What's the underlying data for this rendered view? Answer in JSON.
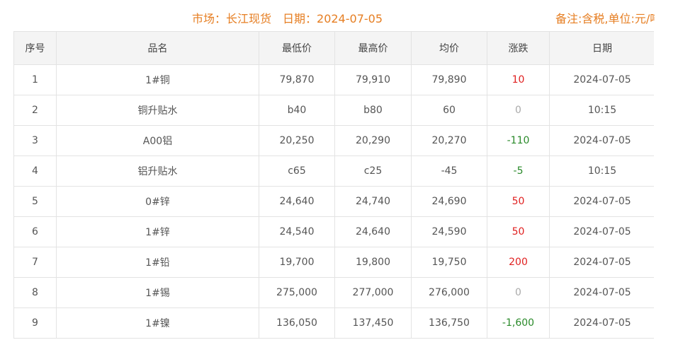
{
  "header": {
    "market_label": "市场：长江现货",
    "date_label": "日期：2024-07-05",
    "remark": "备注:含税,单位:元/吨"
  },
  "colors": {
    "accent": "#e67e22",
    "up": "#e02020",
    "down": "#2a8a2a",
    "flat": "#aaaaaa"
  },
  "table": {
    "columns": [
      "序号",
      "品名",
      "最低价",
      "最高价",
      "均价",
      "涨跌",
      "日期"
    ],
    "rows": [
      {
        "no": "1",
        "name": "1#铜",
        "low": "79,870",
        "high": "79,910",
        "avg": "79,890",
        "change": "10",
        "trend": "up",
        "date": "2024-07-05"
      },
      {
        "no": "2",
        "name": "铜升贴水",
        "low": "b40",
        "high": "b80",
        "avg": "60",
        "change": "0",
        "trend": "flat",
        "date": "10:15"
      },
      {
        "no": "3",
        "name": "A00铝",
        "low": "20,250",
        "high": "20,290",
        "avg": "20,270",
        "change": "-110",
        "trend": "down",
        "date": "2024-07-05"
      },
      {
        "no": "4",
        "name": "铝升贴水",
        "low": "c65",
        "high": "c25",
        "avg": "-45",
        "change": "-5",
        "trend": "down",
        "date": "10:15"
      },
      {
        "no": "5",
        "name": "0#锌",
        "low": "24,640",
        "high": "24,740",
        "avg": "24,690",
        "change": "50",
        "trend": "up",
        "date": "2024-07-05"
      },
      {
        "no": "6",
        "name": "1#锌",
        "low": "24,540",
        "high": "24,640",
        "avg": "24,590",
        "change": "50",
        "trend": "up",
        "date": "2024-07-05"
      },
      {
        "no": "7",
        "name": "1#铅",
        "low": "19,700",
        "high": "19,800",
        "avg": "19,750",
        "change": "200",
        "trend": "up",
        "date": "2024-07-05"
      },
      {
        "no": "8",
        "name": "1#锡",
        "low": "275,000",
        "high": "277,000",
        "avg": "276,000",
        "change": "0",
        "trend": "flat",
        "date": "2024-07-05"
      },
      {
        "no": "9",
        "name": "1#镍",
        "low": "136,050",
        "high": "137,450",
        "avg": "136,750",
        "change": "-1,600",
        "trend": "down",
        "date": "2024-07-05"
      }
    ]
  }
}
